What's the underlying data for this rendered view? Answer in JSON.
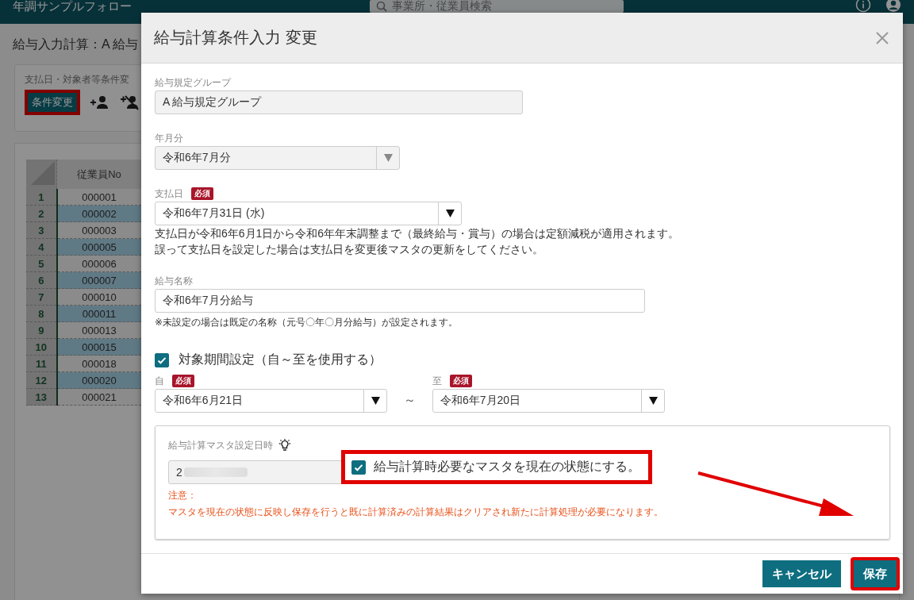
{
  "app": {
    "title": "年調サンプルフォロー",
    "search_placeholder": "事業所・従業員検索"
  },
  "page": {
    "heading": "給与入力計算：A 給与",
    "section_label": "支払日・対象者等条件変",
    "condition_button": {
      "label": "条件変更",
      "highlighted": true
    }
  },
  "table": {
    "columns": [
      "従業員No"
    ],
    "rows": [
      {
        "index": "1",
        "employee_no": "000001"
      },
      {
        "index": "2",
        "employee_no": "000002"
      },
      {
        "index": "3",
        "employee_no": "000003"
      },
      {
        "index": "4",
        "employee_no": "000005"
      },
      {
        "index": "5",
        "employee_no": "000006"
      },
      {
        "index": "6",
        "employee_no": "000007"
      },
      {
        "index": "7",
        "employee_no": "000010"
      },
      {
        "index": "8",
        "employee_no": "000011"
      },
      {
        "index": "9",
        "employee_no": "000013"
      },
      {
        "index": "10",
        "employee_no": "000015"
      },
      {
        "index": "11",
        "employee_no": "000018"
      },
      {
        "index": "12",
        "employee_no": "000020"
      },
      {
        "index": "13",
        "employee_no": "000021"
      }
    ]
  },
  "dialog": {
    "title": "給与計算条件入力 変更",
    "group": {
      "label": "給与規定グループ",
      "value": "A 給与規定グループ",
      "disabled": true
    },
    "month": {
      "label": "年月分",
      "value": "令和6年7月分",
      "disabled": true
    },
    "pay_date": {
      "label": "支払日",
      "badge": "必須",
      "value": "令和6年7月31日 (水)",
      "disabled": false,
      "notes": [
        "支払日が令和6年6月1日から令和6年年末調整まで（最終給与・賞与）の場合は定額減税が適用されます。",
        "誤って支払日を設定した場合は支払日を変更後マスタの更新をしてください。"
      ]
    },
    "salary_name": {
      "label": "給与名称",
      "value": "令和6年7月分給与",
      "note": "※未設定の場合は既定の名称（元号〇年〇月分給与）が設定されます。"
    },
    "period": {
      "checkbox": {
        "label": "対象期間設定（自～至を使用する）",
        "checked": true
      },
      "from": {
        "label": "自",
        "badge": "必須",
        "value": "令和6年6月21日",
        "disabled": false
      },
      "separator": "～",
      "to": {
        "label": "至",
        "badge": "必須",
        "value": "令和6年7月20日",
        "disabled": false
      }
    },
    "master": {
      "label": "給与計算マスタ設定日時",
      "value": "2",
      "checkbox": {
        "label": "給与計算時必要なマスタを現在の状態にする。",
        "checked": true,
        "highlighted": true
      },
      "caution_title": "注意：",
      "caution": "マスタを現在の状態に反映し保存を行うと既に計算済みの計算結果はクリアされ新たに計算処理が必要になります。"
    },
    "buttons": [
      {
        "label": "キャンセル",
        "highlighted": false
      },
      {
        "label": "保存",
        "highlighted": true
      }
    ]
  }
}
